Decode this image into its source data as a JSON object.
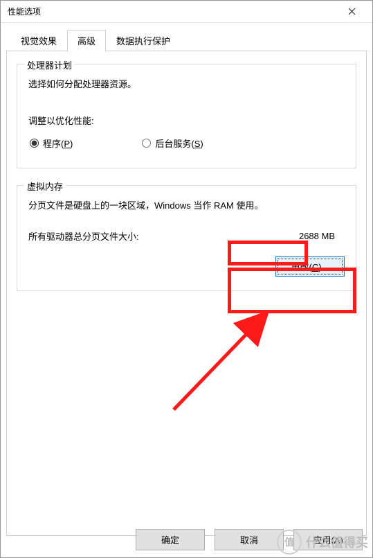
{
  "window": {
    "title": "性能选项"
  },
  "tabs": {
    "visual": "视觉效果",
    "advanced": "高级",
    "dep": "数据执行保护"
  },
  "scheduling": {
    "legend": "处理器计划",
    "desc": "选择如何分配处理器资源。",
    "subhead": "调整以优化性能:",
    "programs_prefix": "程序(",
    "programs_key": "P",
    "programs_suffix": ")",
    "services_prefix": "后台服务(",
    "services_key": "S",
    "services_suffix": ")"
  },
  "vm": {
    "legend": "虚拟内存",
    "desc": "分页文件是硬盘上的一块区域，Windows 当作 RAM 使用。",
    "total_label": "所有驱动器总分页文件大小:",
    "total_value": "2688 MB",
    "change_prefix": "更改(",
    "change_key": "C",
    "change_suffix": ")..."
  },
  "actions": {
    "ok": "确定",
    "cancel": "取消",
    "apply": "应用(A)"
  },
  "watermark": {
    "logo_text": "值",
    "text": "什么值得买"
  }
}
